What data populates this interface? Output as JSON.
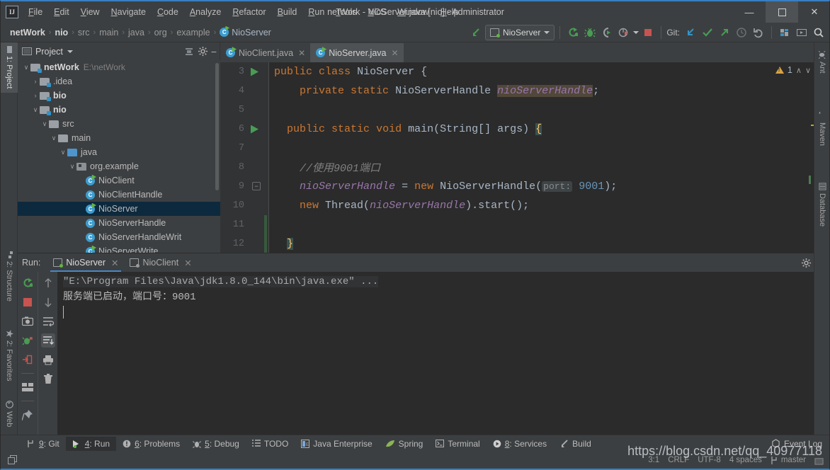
{
  "window": {
    "title": "netWork - NioServer.java [nio] - Administrator",
    "minimize": "—",
    "maximize": "☐",
    "close": "✕"
  },
  "menubar": {
    "items": [
      {
        "label": "File"
      },
      {
        "label": "Edit"
      },
      {
        "label": "View"
      },
      {
        "label": "Navigate"
      },
      {
        "label": "Code"
      },
      {
        "label": "Analyze"
      },
      {
        "label": "Refactor"
      },
      {
        "label": "Build"
      },
      {
        "label": "Run"
      },
      {
        "label": "Tools"
      },
      {
        "label": "VCS"
      },
      {
        "label": "Window"
      },
      {
        "label": "Help"
      }
    ]
  },
  "breadcrumb": {
    "items": [
      "netWork",
      "nio",
      "src",
      "main",
      "java",
      "org",
      "example",
      "NioServer"
    ]
  },
  "toolbar": {
    "run_config": "NioServer",
    "git_label": "Git:",
    "icons": [
      "back-arrow-icon",
      "run-config-selector",
      "rerun-icon",
      "debug-icon",
      "run-with-coverage-icon",
      "profiler-icon",
      "stop-icon",
      "git-update-icon",
      "git-commit-icon",
      "git-push-icon",
      "git-history-icon",
      "git-revert-icon",
      "settings-icon",
      "layout-icon",
      "search-icon"
    ]
  },
  "left_strip": {
    "tabs": [
      {
        "label": "1: Project",
        "selected": true
      },
      {
        "label": "2: Structure",
        "selected": false
      },
      {
        "label": "2: Favorites",
        "selected": false
      },
      {
        "label": "Web",
        "selected": false
      }
    ]
  },
  "right_strip": {
    "tabs": [
      {
        "label": "Ant"
      },
      {
        "label": "Maven"
      },
      {
        "label": "Database"
      }
    ]
  },
  "project_panel": {
    "title": "Project",
    "tree": [
      {
        "label": "netWork",
        "path": "E:\\netWork",
        "indent": 0,
        "twist": "∨",
        "icon": "module-folder",
        "bold": true,
        "selected": false
      },
      {
        "label": ".idea",
        "path": "",
        "indent": 1,
        "twist": "›",
        "icon": "folder-src",
        "bold": false,
        "selected": false
      },
      {
        "label": "bio",
        "path": "",
        "indent": 1,
        "twist": "›",
        "icon": "folder-src",
        "bold": true,
        "selected": false
      },
      {
        "label": "nio",
        "path": "",
        "indent": 1,
        "twist": "∨",
        "icon": "folder-src",
        "bold": true,
        "selected": false
      },
      {
        "label": "src",
        "path": "",
        "indent": 2,
        "twist": "∨",
        "icon": "folder-plain",
        "bold": false,
        "selected": false
      },
      {
        "label": "main",
        "path": "",
        "indent": 3,
        "twist": "∨",
        "icon": "folder-plain",
        "bold": false,
        "selected": false
      },
      {
        "label": "java",
        "path": "",
        "indent": 4,
        "twist": "∨",
        "icon": "folder-source-blue",
        "bold": false,
        "selected": false
      },
      {
        "label": "org.example",
        "path": "",
        "indent": 5,
        "twist": "∨",
        "icon": "package",
        "bold": false,
        "selected": false
      },
      {
        "label": "NioClient",
        "path": "",
        "indent": 6,
        "twist": "",
        "icon": "class-runnable",
        "bold": false,
        "selected": false
      },
      {
        "label": "NioClientHandle",
        "path": "",
        "indent": 6,
        "twist": "",
        "icon": "class",
        "bold": false,
        "selected": false
      },
      {
        "label": "NioServer",
        "path": "",
        "indent": 6,
        "twist": "",
        "icon": "class-runnable",
        "bold": false,
        "selected": true
      },
      {
        "label": "NioServerHandle",
        "path": "",
        "indent": 6,
        "twist": "",
        "icon": "class",
        "bold": false,
        "selected": false
      },
      {
        "label": "NioServerHandleWrit",
        "path": "",
        "indent": 6,
        "twist": "",
        "icon": "class",
        "bold": false,
        "selected": false
      },
      {
        "label": "NioServerWrite",
        "path": "",
        "indent": 6,
        "twist": "",
        "icon": "class-runnable",
        "bold": false,
        "selected": false
      }
    ]
  },
  "editor": {
    "tabs": [
      {
        "label": "NioClient.java",
        "active": false,
        "close": "✕"
      },
      {
        "label": "NioServer.java",
        "active": true,
        "close": "✕"
      }
    ],
    "warning_count": "1",
    "chev_up": "∧",
    "chev_down": "∨",
    "lines": [
      {
        "num": "3",
        "runmark": true,
        "fold": false
      },
      {
        "num": "4",
        "runmark": false,
        "fold": false
      },
      {
        "num": "5",
        "runmark": false,
        "fold": false
      },
      {
        "num": "6",
        "runmark": true,
        "fold": true
      },
      {
        "num": "7",
        "runmark": false,
        "fold": false
      },
      {
        "num": "8",
        "runmark": false,
        "fold": false
      },
      {
        "num": "9",
        "runmark": false,
        "fold": false
      },
      {
        "num": "10",
        "runmark": false,
        "fold": false
      },
      {
        "num": "11",
        "runmark": false,
        "fold": false
      },
      {
        "num": "12",
        "runmark": false,
        "fold": true
      }
    ],
    "code": {
      "l3_kw1": "public",
      "l3_kw2": "class",
      "l3_name": "NioServer",
      "l3_brace": "{",
      "l4_kw1": "private",
      "l4_kw2": "static",
      "l4_type": "NioServerHandle",
      "l4_field": "nioServerHandle",
      "l4_semi": ";",
      "l6_kw1": "public",
      "l6_kw2": "static",
      "l6_kw3": "void",
      "l6_name": "main",
      "l6_params": "(String[] args)",
      "l6_brace": "{",
      "l8_comment": "//使用9001端口",
      "l9_field": "nioServerHandle",
      "l9_eq": "=",
      "l9_new": "new",
      "l9_ctor": "NioServerHandle(",
      "l9_hint": "port:",
      "l9_port": "9001",
      "l9_tail": ");",
      "l10_new": "new",
      "l10_thread": "Thread(",
      "l10_arg": "nioServerHandle",
      "l10_tail": ").start();",
      "l12_brace": "}"
    }
  },
  "run_panel": {
    "label": "Run:",
    "tabs": [
      {
        "label": "NioServer",
        "active": true,
        "close": "✕"
      },
      {
        "label": "NioClient",
        "active": false,
        "close": "✕"
      }
    ],
    "settings_icon": "gear-icon",
    "minimize_icon": "minimize-icon",
    "left_tools": [
      "rerun-icon",
      "stop-icon",
      "screenshot-icon",
      "dump-threads-icon",
      "exit-icon",
      "layout-icon",
      "pin-icon"
    ],
    "right_tools": [
      "up-arrow-icon",
      "down-arrow-icon",
      "soft-wrap-icon",
      "scroll-to-end-icon",
      "print-icon",
      "trash-icon"
    ],
    "console": {
      "line1": "\"E:\\Program Files\\Java\\jdk1.8.0_144\\bin\\java.exe\" ...",
      "line2": "服务端已启动，端口号：9001"
    }
  },
  "bottom_bar": {
    "buttons": [
      {
        "label": "9: Git",
        "icon": "git-branch-icon",
        "active": false
      },
      {
        "label": "4: Run",
        "icon": "run-icon",
        "active": true
      },
      {
        "label": "6: Problems",
        "icon": "problems-icon",
        "active": false
      },
      {
        "label": "5: Debug",
        "icon": "debug-icon",
        "active": false
      },
      {
        "label": "TODO",
        "icon": "todo-icon",
        "active": false
      },
      {
        "label": "Java Enterprise",
        "icon": "java-ee-icon",
        "active": false
      },
      {
        "label": "Spring",
        "icon": "spring-leaf-icon",
        "active": false
      },
      {
        "label": "Terminal",
        "icon": "terminal-icon",
        "active": false
      },
      {
        "label": "8: Services",
        "icon": "services-icon",
        "active": false
      },
      {
        "label": "Build",
        "icon": "build-hammer-icon",
        "active": false
      }
    ],
    "event_log": "Event Log"
  },
  "status_bar": {
    "caret": "3:1",
    "line_sep": "CRLF",
    "encoding": "UTF-8",
    "indent": "4 spaces",
    "branch": "master"
  },
  "watermark": {
    "text": "https://blog.csdn.net/qq_40977118"
  },
  "colors": {
    "accent_blue": "#3a7fc1",
    "panel_bg": "#3c3f41",
    "editor_bg": "#2b2b2b",
    "selection": "#0d293e",
    "keyword": "#cc7832",
    "field": "#9876aa",
    "number": "#6897bb",
    "comment": "#808080",
    "text": "#a9b7c6",
    "green": "#62b543",
    "warning": "#d9a343"
  }
}
